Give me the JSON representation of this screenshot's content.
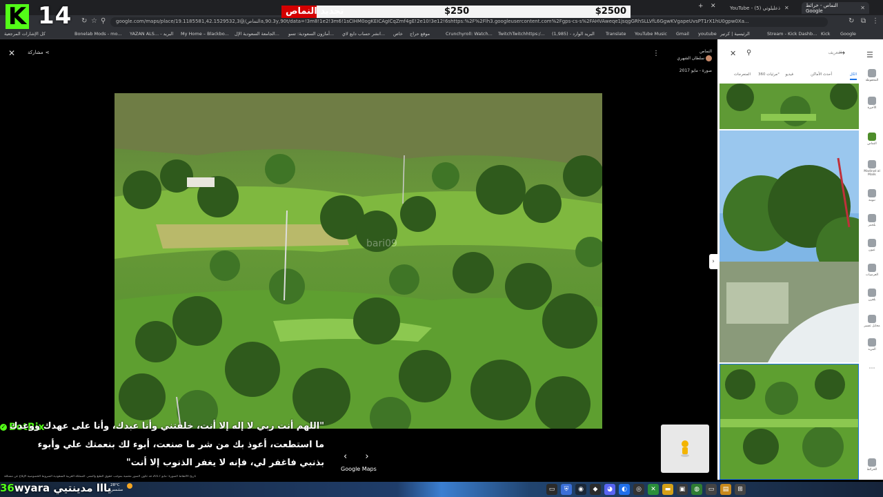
{
  "browser": {
    "tabs": [
      {
        "title": "YouTube - (5) ذعليلوتي",
        "active": false
      },
      {
        "title": "النماص - خرائط Google",
        "active": true
      }
    ],
    "url": "google.com/maps/place/النماص/@19.1185581,42.1529532,3a,90.3y,90t/data=!3m8!1e2!3m6!1sCIHM0ogKEICAgICqZmf4gE!2e10!3e12!6shttps:%2F%2Flh3.googleusercontent.com%2Fgps-cs-s%2FAHVAweqe1jsqgGRhSLLVfL6GgwKVgapeUvsPT1rX1hU0gpw0Xa...",
    "bookmarks": [
      "كل الإشارات المرجعية",
      "Bonelab Mods - mo...",
      "YAZAN ALS... - البريد",
      "My Home – Blackbo...",
      "الجامعة السعودية الإل...",
      "أمازون السعودية: تسو...",
      "انشر حساب دايع لاي...",
      "خاص",
      "موقع حراج",
      "Crunchyroll: Watch...",
      "TwitchTwitchhttps:/...",
      "(1,985) - البريد الوارد",
      "Translate",
      "YouTube Music",
      "Gmail",
      "youtube",
      "الرئيسية | كرتير",
      "Stream - Kick Dashb...",
      "Kick",
      "Google"
    ]
  },
  "overlay": {
    "k_logo": "K",
    "k_count": "14",
    "goal_label": "تجديد النماص",
    "goal_mid": "$250",
    "goal_target": "$2500",
    "goal_progress": 0.1,
    "accent_color": "#53fc18",
    "goal_fill_color": "#d40000"
  },
  "maps": {
    "share_label": "مشاركة",
    "place_title": "النماص",
    "author_name": "سلطان الشهري",
    "photo_date": "صورة - مايو 2017",
    "watermark": "bari09",
    "google_maps_label": "Google Maps",
    "footer_text": "تاريخ الالتقاط الصورة: مايو 2017   قد تكون الصور محمية بموجب حقوق الطبع والنشر.   المملكة العربية السعودية   الشروط   الخصوصية   الإبلاغ عن مشكلة",
    "panel": {
      "search_placeholder": "التعريف",
      "tabs": [
        "الكل",
        "أحدث الأماكن",
        "فيديو",
        "مرئيات 360°",
        "المنعرجات"
      ]
    },
    "rail": [
      {
        "label": "المحفوظة"
      },
      {
        "label": "الأخيرة"
      },
      {
        "label": "النماص"
      },
      {
        "label": "Madinat al Malik"
      },
      {
        "label": "تنومة"
      },
      {
        "label": "بلحمر"
      },
      {
        "label": "عيون"
      },
      {
        "label": "العرضيات"
      },
      {
        "label": "بلقرن"
      },
      {
        "label": "محايل عسير"
      },
      {
        "label": "المزيد"
      },
      {
        "label": "الخرائط"
      }
    ]
  },
  "chat": {
    "username": "BotRix",
    "lines": [
      "\"اللهم أنت ربي لا إله إلا أنت، خلقتني وأنا عبدك، وأنا على عهدك ووعدك",
      "ما استطعت، أعوذ بك من شر ما صنعت، أبوء لك بنعمتك علي وأبوء",
      "بذنبي فاغفر لي، فإنه لا يغفر الذنوب إلا أنت\""
    ]
  },
  "ticker": {
    "count": "36",
    "text": "wyara يااا مدينتيي"
  },
  "taskbar": {
    "temperature": "28°C",
    "condition": "مشمس"
  }
}
